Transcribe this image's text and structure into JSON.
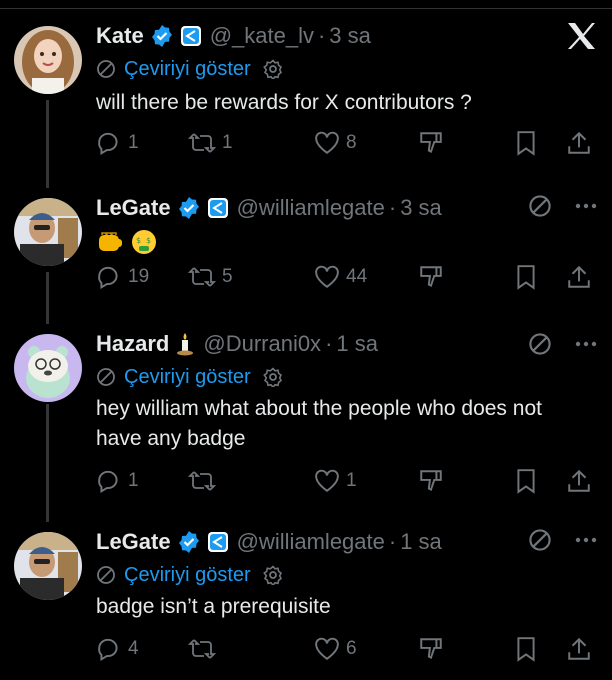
{
  "accent": "#1d9bf0",
  "tweets": [
    {
      "name": "Kate",
      "handle": "@_kate_lv",
      "time": "3 sa",
      "translate": "Çeviriyi göster",
      "text": "will there be rewards for X contributors ?",
      "reply": "1",
      "retweet": "1",
      "like": "8"
    },
    {
      "name": "LeGate",
      "handle": "@williamlegate",
      "time": "3 sa",
      "emojis": [
        "fist-emoji",
        "money-face-emoji"
      ],
      "reply": "19",
      "retweet": "5",
      "like": "44"
    },
    {
      "name": "Hazard",
      "handle": "@Durrani0x",
      "time": "1 sa",
      "translate": "Çeviriyi göster",
      "text": "hey william what about the people who does not have any badge",
      "reply": "1",
      "retweet": "",
      "like": "1"
    },
    {
      "name": "LeGate",
      "handle": "@williamlegate",
      "time": "1 sa",
      "translate": "Çeviriyi göster",
      "text": "badge isn’t a prerequisite",
      "reply": "4",
      "retweet": "",
      "like": "6"
    }
  ],
  "separator": "·"
}
